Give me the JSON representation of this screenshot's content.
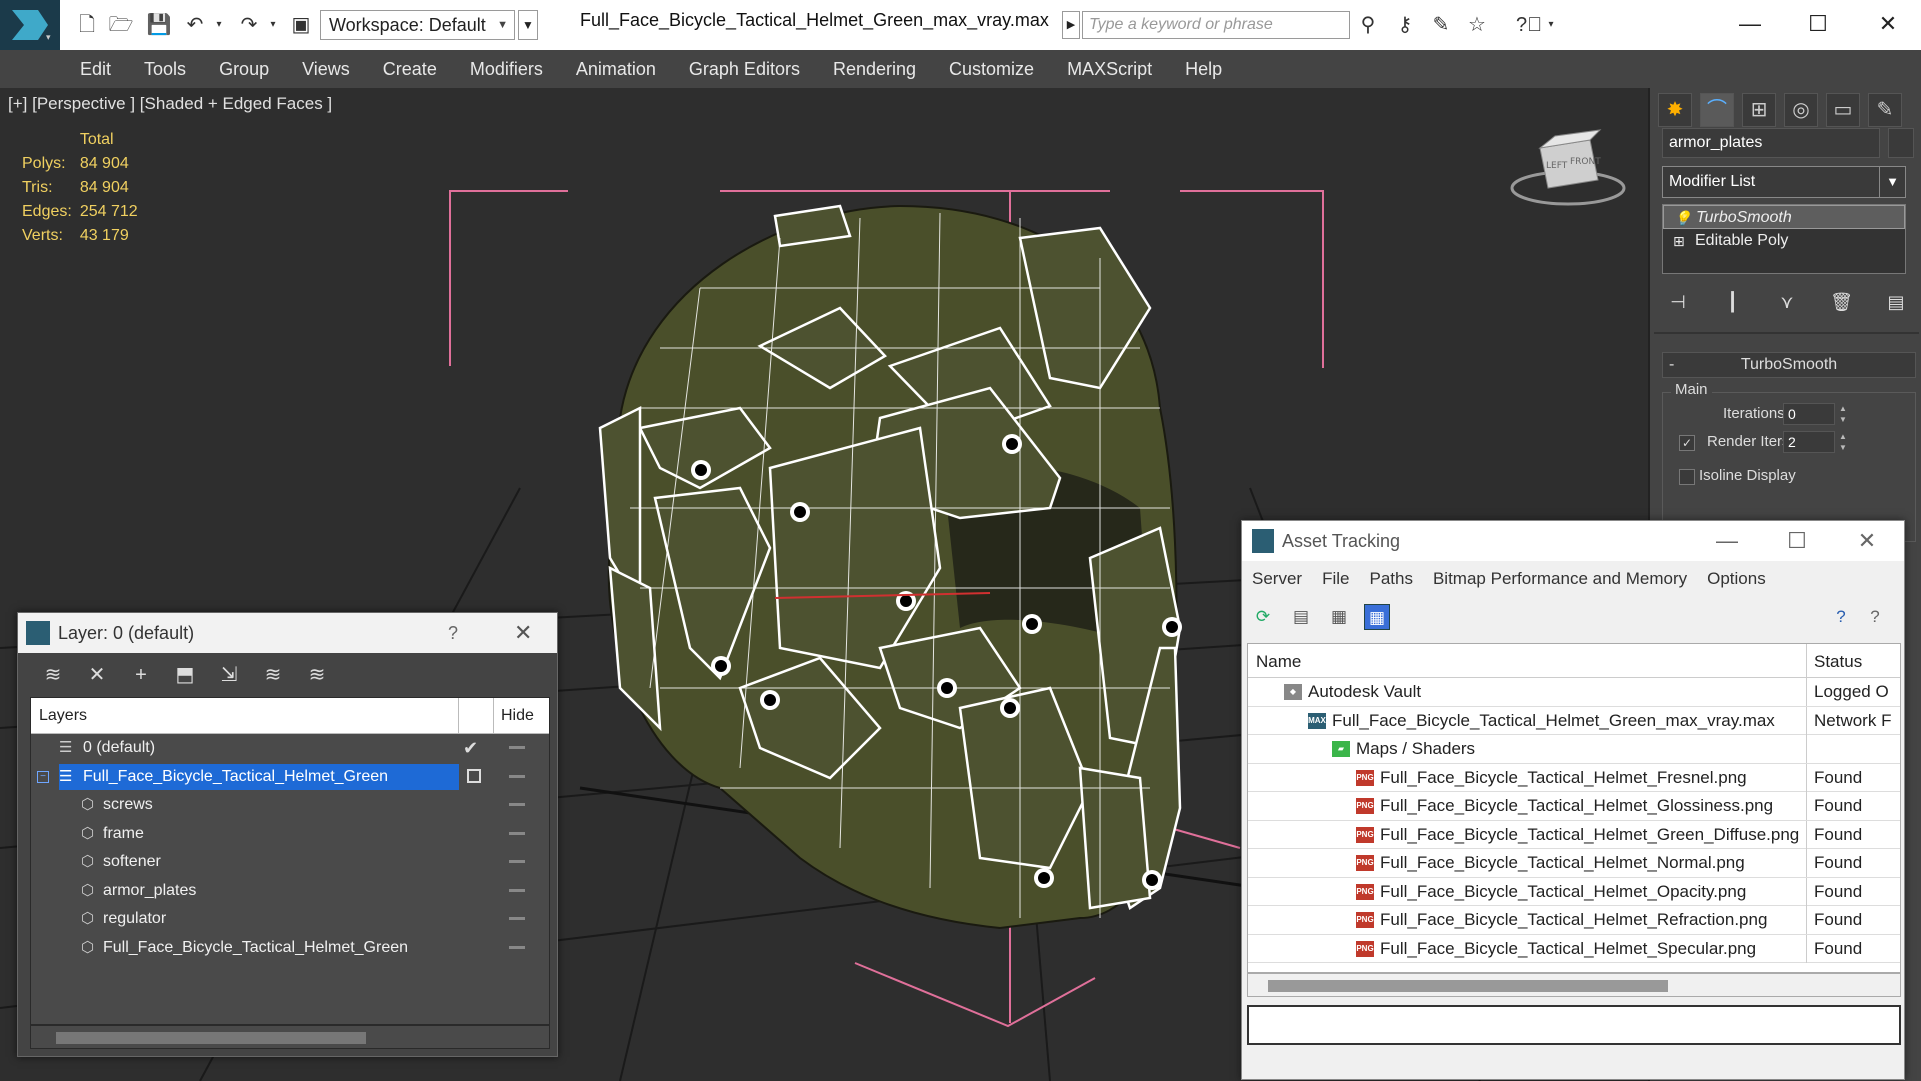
{
  "app": {
    "document_title": "Full_Face_Bicycle_Tactical_Helmet_Green_max_vray.max",
    "workspace_label": "Workspace: Default",
    "search_placeholder": "Type a keyword or phrase"
  },
  "menu": [
    "Edit",
    "Tools",
    "Group",
    "Views",
    "Create",
    "Modifiers",
    "Animation",
    "Graph Editors",
    "Rendering",
    "Customize",
    "MAXScript",
    "Help"
  ],
  "viewport": {
    "label": "[+] [Perspective ] [Shaded + Edged Faces ]",
    "stats": {
      "header": "Total",
      "rows": [
        {
          "label": "Polys:",
          "value": "84 904"
        },
        {
          "label": "Tris:",
          "value": "84 904"
        },
        {
          "label": "Edges:",
          "value": "254 712"
        },
        {
          "label": "Verts:",
          "value": "43 179"
        }
      ]
    },
    "viewcube": {
      "left": "LEFT",
      "front": "FRONT"
    }
  },
  "command_panel": {
    "object_name": "armor_plates",
    "modifier_list": "Modifier List",
    "stack": [
      "TurboSmooth",
      "Editable Poly"
    ],
    "rollout_title": "TurboSmooth",
    "group_label": "Main",
    "iterations_label": "Iterations:",
    "iterations_value": "0",
    "render_iters_label": "Render Iters:",
    "render_iters_value": "2",
    "isoline_label": "Isoline Display"
  },
  "layer_dialog": {
    "title": "Layer: 0 (default)",
    "help": "?",
    "col_layers": "Layers",
    "col_hide": "Hide",
    "rows": [
      {
        "label": "0 (default)",
        "level": 0
      },
      {
        "label": "Full_Face_Bicycle_Tactical_Helmet_Green",
        "level": 0
      },
      {
        "label": "screws",
        "level": 1
      },
      {
        "label": "frame",
        "level": 1
      },
      {
        "label": "softener",
        "level": 1
      },
      {
        "label": "armor_plates",
        "level": 1
      },
      {
        "label": "regulator",
        "level": 1
      },
      {
        "label": "Full_Face_Bicycle_Tactical_Helmet_Green",
        "level": 1
      }
    ]
  },
  "asset_dialog": {
    "title": "Asset Tracking",
    "menu": [
      "Server",
      "File",
      "Paths",
      "Bitmap Performance and Memory",
      "Options"
    ],
    "col_name": "Name",
    "col_status": "Status",
    "rows": [
      {
        "name": "Autodesk Vault",
        "status": "Logged O",
        "icon": "vault"
      },
      {
        "name": "Full_Face_Bicycle_Tactical_Helmet_Green_max_vray.max",
        "status": "Network F",
        "icon": "max"
      },
      {
        "name": "Maps / Shaders",
        "status": "",
        "icon": "maps"
      },
      {
        "name": "Full_Face_Bicycle_Tactical_Helmet_Fresnel.png",
        "status": "Found",
        "icon": "png"
      },
      {
        "name": "Full_Face_Bicycle_Tactical_Helmet_Glossiness.png",
        "status": "Found",
        "icon": "png"
      },
      {
        "name": "Full_Face_Bicycle_Tactical_Helmet_Green_Diffuse.png",
        "status": "Found",
        "icon": "png"
      },
      {
        "name": "Full_Face_Bicycle_Tactical_Helmet_Normal.png",
        "status": "Found",
        "icon": "png"
      },
      {
        "name": "Full_Face_Bicycle_Tactical_Helmet_Opacity.png",
        "status": "Found",
        "icon": "png"
      },
      {
        "name": "Full_Face_Bicycle_Tactical_Helmet_Refraction.png",
        "status": "Found",
        "icon": "png"
      },
      {
        "name": "Full_Face_Bicycle_Tactical_Helmet_Specular.png",
        "status": "Found",
        "icon": "png"
      }
    ]
  },
  "colors": {
    "helmet": "#4a4f2a",
    "wire": "#ffffff",
    "selection_bracket": "#e0709a",
    "active_layer": "#1e6ad6",
    "stats": "#f0d060"
  }
}
